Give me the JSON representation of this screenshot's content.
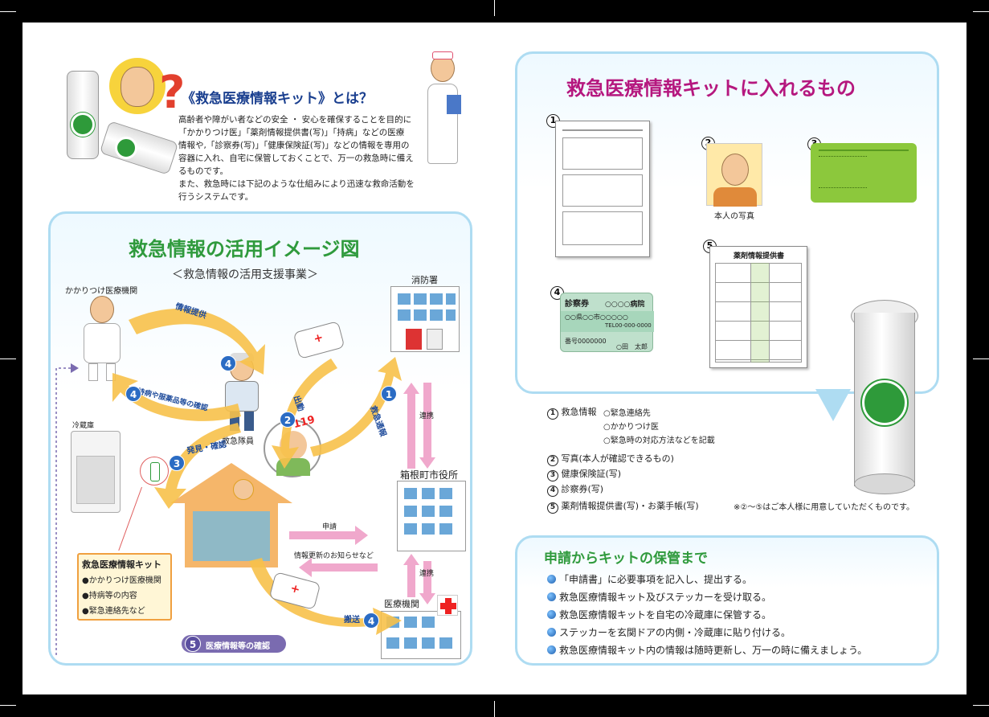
{
  "intro": {
    "title": "《救急医療情報キット》とは？",
    "lines": [
      "高齢者や障がい者などの安全 ・ 安心を確保することを目的に",
      "「かかりつけ医」「薬剤情報提供書(写)」「持病」などの医療",
      "情報や,「診察券(写)」「健康保険証(写)」などの情報を専用の",
      "容器に入れ、自宅に保管しておくことで、万一の救急時に備え",
      "るものです。",
      "また、救急時には下記のような仕組みにより迅速な救命活動を",
      "行うシステムです。"
    ]
  },
  "diagram": {
    "title": "救急情報の活用イメージ図",
    "subtitle": "＜救急情報の活用支援事業＞",
    "clinic_label": "かかりつけ医療機関",
    "fire_station_label": "消防署",
    "fridge_label": "冷蔵庫",
    "paramedic_label": "救急隊員",
    "town_hall_label": "箱根町市役所",
    "hospital_label": "医療機関",
    "phone_label": "119",
    "steps": {
      "s1": "救急通報",
      "s2": "出動",
      "s3": "発見・確認",
      "s4a": "情報提供",
      "s4b": "持病や服薬品等の確認",
      "s4c": "搬送",
      "s5": "医療情報等の確認"
    },
    "nums": {
      "n1": "1",
      "n2": "2",
      "n3": "3",
      "n4": "4",
      "n5": "5"
    },
    "renkei": "連携",
    "shinsei": "申請",
    "info_update": "情報更新のお知らせなど",
    "kit_box": {
      "title": "救急医療情報キット",
      "items": [
        "●かかりつけ医療機関",
        "●持病等の内容",
        "●緊急連絡先など"
      ]
    }
  },
  "contents": {
    "title": "救急医療情報キットに入れるもの",
    "n1": "1",
    "n2": "2",
    "n3": "3",
    "n4": "4",
    "n5": "5",
    "photo_caption": "本人の写真",
    "card_text": "診察券",
    "card_hospital": "○○○○病院",
    "card_address": "○○県○○市○○○○○",
    "card_tel": "TEL00-000-0000",
    "card_number": "番号0000000",
    "card_name": "○田　太郎",
    "pharmacy_title": "薬剤情報提供書",
    "list": {
      "item1_label": "救急情報",
      "item1_details": [
        "○緊急連絡先",
        "○かかりつけ医",
        "○緊急時の対応方法などを記載"
      ],
      "item2": "写真(本人が確認できるもの)",
      "item3": "健康保険証(写)",
      "item4": "診察券(写)",
      "item5": "薬剤情報提供書(写)・お薬手帳(写)",
      "note": "※②～⑤はご本人様に用意していただくものです。"
    }
  },
  "process": {
    "title": "申請からキットの保管まで",
    "items": [
      "「申請書」に必要事項を記入し、提出する。",
      "救急医療情報キット及びステッカーを受け取る。",
      "救急医療情報キットを自宅の冷蔵庫に保管する。",
      "ステッカーを玄関ドアの内側・冷蔵庫に貼り付ける。",
      "救急医療情報キット内の情報は随時更新し、万一の時に備えましょう。"
    ]
  },
  "colors": {
    "title_green": "#2f9a3c",
    "title_magenta": "#b5177e",
    "panel_border": "#aedcf2",
    "arrow_yellow": "#f7c14a",
    "arrow_pink": "#f0a8cc",
    "kit_box_border": "#f0a040"
  }
}
